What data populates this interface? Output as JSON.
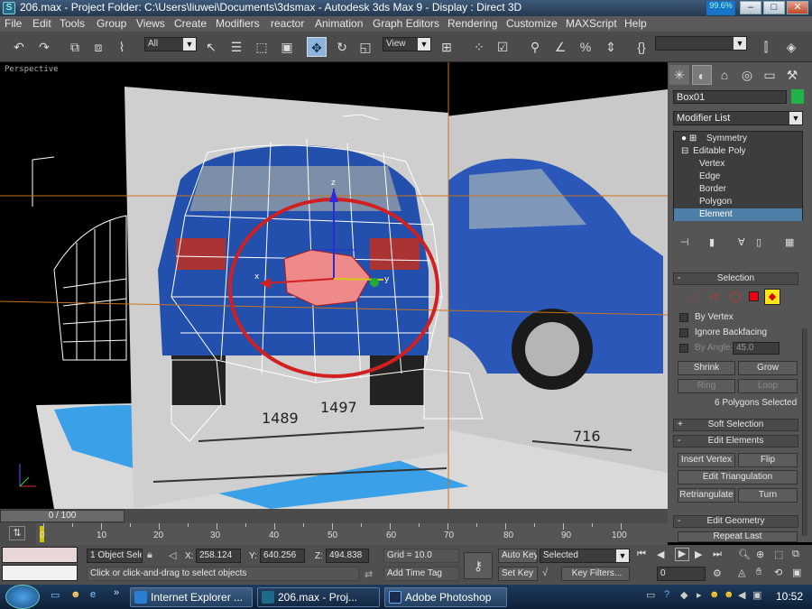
{
  "window": {
    "title": "206.max    - Project Folder: C:\\Users\\liuwei\\Documents\\3dsmax    - Autodesk 3ds Max 9    - Display : Direct 3D",
    "meter": "99.6%"
  },
  "menu": [
    "File",
    "Edit",
    "Tools",
    "Group",
    "Views",
    "Create",
    "Modifiers",
    "reactor",
    "Animation",
    "Graph Editors",
    "Rendering",
    "Customize",
    "MAXScript",
    "Help"
  ],
  "toolbar": {
    "selection_filter": "All",
    "reference_coord": "View",
    "named_selection": ""
  },
  "viewport": {
    "label": "Perspective",
    "dimensions": [
      "1489",
      "1497",
      "716"
    ],
    "axis": {
      "x": "x",
      "y": "y",
      "z": "z"
    }
  },
  "command_panel": {
    "object_name": "Box01",
    "modifier_list": "Modifier List",
    "stack": [
      {
        "label": "Symmetry",
        "type": "modifier"
      },
      {
        "label": "Editable Poly",
        "type": "base"
      },
      {
        "label": "Vertex",
        "type": "sub"
      },
      {
        "label": "Edge",
        "type": "sub"
      },
      {
        "label": "Border",
        "type": "sub"
      },
      {
        "label": "Polygon",
        "type": "sub"
      },
      {
        "label": "Element",
        "type": "sub-selected"
      }
    ],
    "selection": {
      "title": "Selection",
      "by_vertex": "By Vertex",
      "ignore_backfacing": "Ignore Backfacing",
      "by_angle": "By Angle:",
      "angle_value": "45.0",
      "shrink": "Shrink",
      "grow": "Grow",
      "ring": "Ring",
      "loop": "Loop",
      "status": "6 Polygons Selected"
    },
    "soft_selection": "Soft Selection",
    "edit_elements": {
      "title": "Edit Elements",
      "insert_vertex": "Insert Vertex",
      "flip": "Flip",
      "edit_triangulation": "Edit Triangulation",
      "retriangulate": "Retriangulate",
      "turn": "Turn"
    },
    "edit_geometry": "Edit Geometry",
    "repeat_last": "Repeat Last",
    "object_color": "#1fb34a"
  },
  "timeline": {
    "frame": "0 / 100",
    "ticks": [
      "0",
      "10",
      "20",
      "30",
      "40",
      "50",
      "60",
      "70",
      "80",
      "90",
      "100"
    ]
  },
  "status": {
    "selected": "1 Object Sele",
    "x_label": "X:",
    "x": "258.124",
    "y_label": "Y:",
    "y": "640.256",
    "z_label": "Z:",
    "z": "494.838",
    "grid": "Grid = 10.0",
    "prompt": "Click or click-and-drag to select objects",
    "add_time_tag": "Add Time Tag",
    "auto_key": "Auto Key",
    "set_key": "Set Key",
    "key_mode": "Selected",
    "key_filters": "Key Filters...",
    "frame_field": "0"
  },
  "taskbar": {
    "items": [
      "Internet Explorer ...",
      "206.max    - Proj...",
      "Adobe Photoshop"
    ],
    "clock": "10:52"
  }
}
